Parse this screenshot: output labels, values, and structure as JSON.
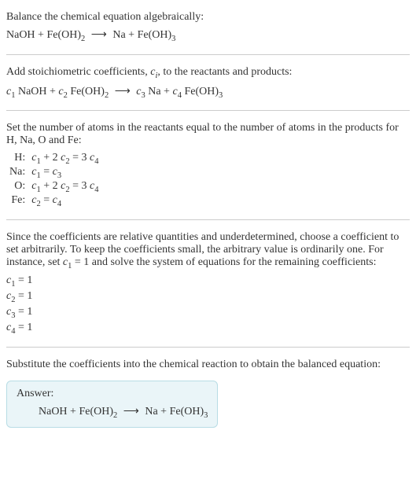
{
  "intro": {
    "line1": "Balance the chemical equation algebraically:"
  },
  "eq1": {
    "r1": "NaOH",
    "plus1": " + ",
    "r2a": "Fe(OH)",
    "r2s": "2",
    "arrow": "⟶",
    "p1": "Na",
    "plus2": " + ",
    "p2a": "Fe(OH)",
    "p2s": "3"
  },
  "step2": {
    "text_a": "Add stoichiometric coefficients, ",
    "ci_c": "c",
    "ci_i": "i",
    "text_b": ", to the reactants and products:"
  },
  "eq2": {
    "c1c": "c",
    "c1s": "1",
    "sp1": " NaOH + ",
    "c2c": "c",
    "c2s": "2",
    "sp2a": " Fe(OH)",
    "sp2s": "2",
    "arrow": "⟶",
    "c3c": "c",
    "c3s": "3",
    "sp3": " Na + ",
    "c4c": "c",
    "c4s": "4",
    "sp4a": " Fe(OH)",
    "sp4s": "3"
  },
  "step3": {
    "text": "Set the number of atoms in the reactants equal to the number of atoms in the products for H, Na, O and Fe:"
  },
  "atoms": {
    "H": {
      "label": "H:"
    },
    "Na": {
      "label": "Na:"
    },
    "O": {
      "label": "O:"
    },
    "Fe": {
      "label": "Fe:"
    }
  },
  "atomeq": {
    "c": "c",
    "s1": "1",
    "s2": "2",
    "s3": "3",
    "s4": "4",
    "plus2": " + 2 ",
    "eq3": " = 3 ",
    "eq": " = "
  },
  "step4": {
    "text_a": "Since the coefficients are relative quantities and underdetermined, choose a coefficient to set arbitrarily. To keep the coefficients small, the arbitrary value is ordinarily one. For instance, set ",
    "c": "c",
    "s1": "1",
    "text_b": " = 1 and solve the system of equations for the remaining coefficients:"
  },
  "coefs": {
    "c": "c",
    "s1": "1",
    "v1": " = 1",
    "s2": "2",
    "v2": " = 1",
    "s3": "3",
    "v3": " = 1",
    "s4": "4",
    "v4": " = 1"
  },
  "step5": {
    "text": "Substitute the coefficients into the chemical reaction to obtain the balanced equation:"
  },
  "answer": {
    "label": "Answer:",
    "r1": "NaOH",
    "plus1": " + ",
    "r2a": "Fe(OH)",
    "r2s": "2",
    "arrow": "⟶",
    "p1": "Na",
    "plus2": " + ",
    "p2a": "Fe(OH)",
    "p2s": "3"
  }
}
